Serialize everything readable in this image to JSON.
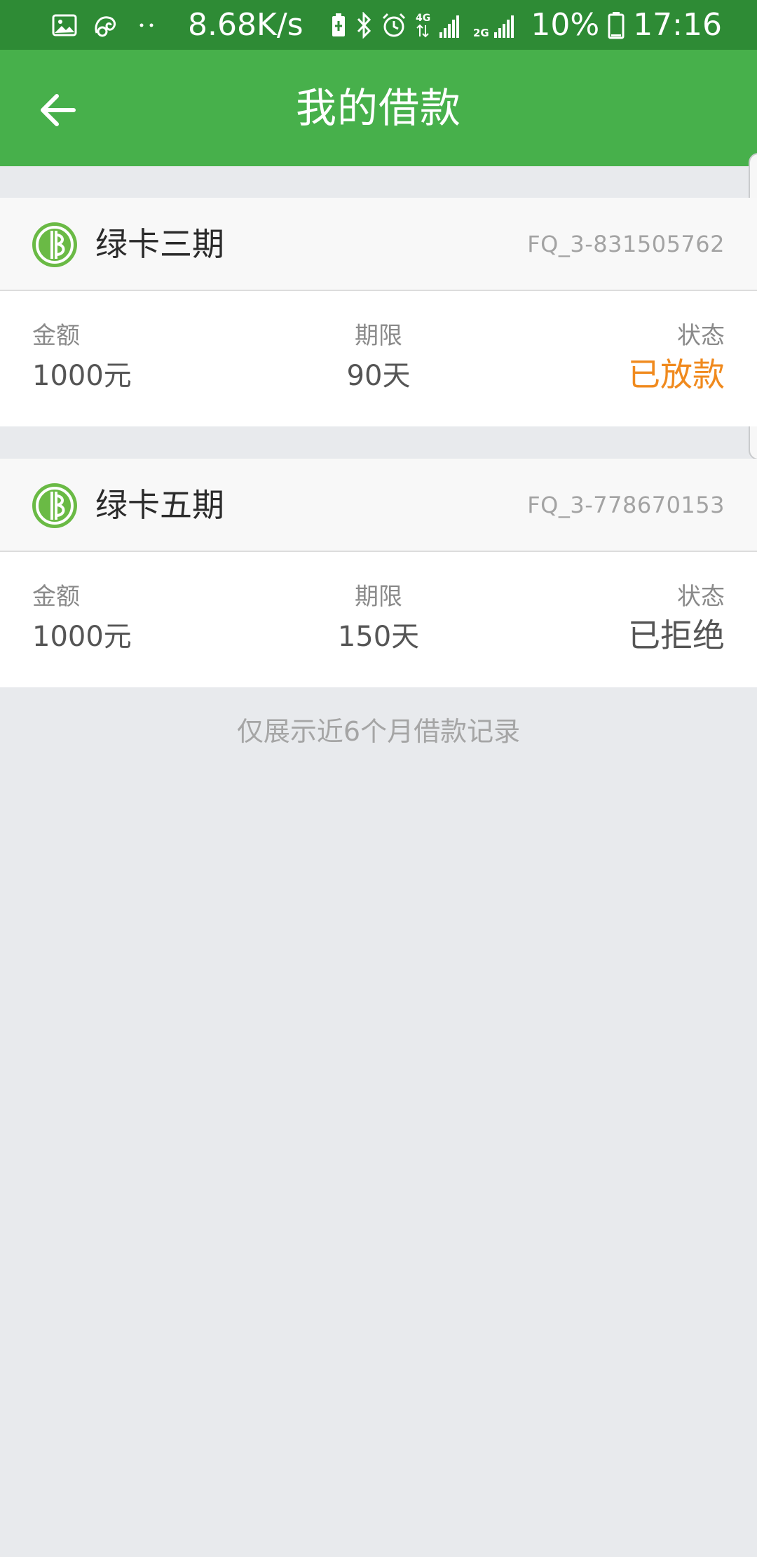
{
  "status_bar": {
    "network_speed": "8.68K/s",
    "network_4g": "4G",
    "network_2g": "2G",
    "battery_percent": "10%",
    "time": "17:16",
    "icons": [
      "image-icon",
      "uc-browser-icon",
      "dots-icon",
      "battery-saver-icon",
      "bluetooth-icon",
      "alarm-icon",
      "signal-icon",
      "signal-icon",
      "battery-icon"
    ]
  },
  "header": {
    "title": "我的借款",
    "background": "#47b04b",
    "back_icon": "arrow-left-icon"
  },
  "loans": [
    {
      "product": "绿卡三期",
      "id": "FQ_3-831505762",
      "amount_label": "金额",
      "amount": "1000元",
      "term_label": "期限",
      "term": "90天",
      "status_label": "状态",
      "status": "已放款",
      "status_color": "#f08a1e"
    },
    {
      "product": "绿卡五期",
      "id": "FQ_3-778670153",
      "amount_label": "金额",
      "amount": "1000元",
      "term_label": "期限",
      "term": "150天",
      "status_label": "状态",
      "status": "已拒绝",
      "status_color": "#555555"
    }
  ],
  "footer_note": "仅展示近6个月借款记录"
}
